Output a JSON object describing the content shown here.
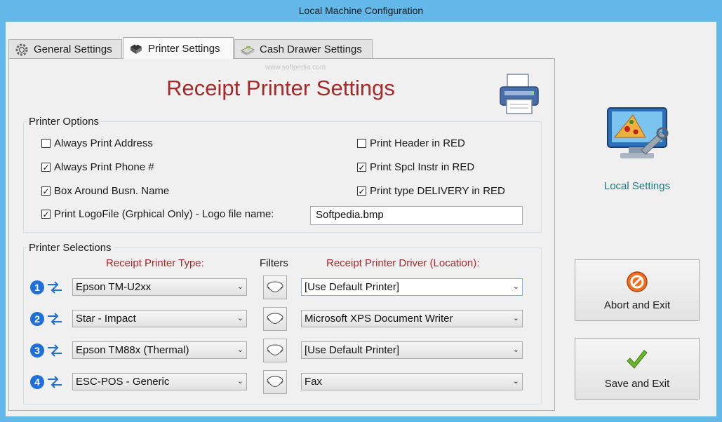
{
  "window": {
    "title": "Local Machine Configuration"
  },
  "tabs": [
    {
      "label": "General Settings",
      "icon": "gear-icon"
    },
    {
      "label": "Printer Settings",
      "icon": "printer-icon",
      "active": true
    },
    {
      "label": "Cash Drawer Settings",
      "icon": "cash-drawer-icon"
    }
  ],
  "watermark": "www.softpedia.com",
  "heading": "Receipt Printer Settings",
  "printer_options": {
    "legend": "Printer Options",
    "left": [
      {
        "label": "Always Print Address",
        "checked": false
      },
      {
        "label": "Always Print Phone #",
        "checked": true
      },
      {
        "label": "Box Around Busn. Name",
        "checked": true
      }
    ],
    "right": [
      {
        "label": "Print Header in RED",
        "checked": false
      },
      {
        "label": "Print Spcl Instr in RED",
        "checked": true
      },
      {
        "label": "Print type DELIVERY in RED",
        "checked": true
      }
    ],
    "logo": {
      "label": "Print LogoFile (Grphical Only) - Logo file name:",
      "checked": true,
      "value": "Softpedia.bmp"
    }
  },
  "printer_selections": {
    "legend": "Printer Selections",
    "col_type": "Receipt Printer Type:",
    "col_filters": "Filters",
    "col_driver": "Receipt Printer Driver (Location):",
    "rows": [
      {
        "num": "1",
        "type": "Epson TM-U2xx",
        "driver": "[Use Default Printer]"
      },
      {
        "num": "2",
        "type": "Star - Impact",
        "driver": "Microsoft XPS Document Writer"
      },
      {
        "num": "3",
        "type": "Epson TM88x (Thermal)",
        "driver": "[Use Default Printer]"
      },
      {
        "num": "4",
        "type": "ESC-POS - Generic",
        "driver": "Fax"
      }
    ]
  },
  "side": {
    "local_label": "Local Settings",
    "abort_label": "Abort and Exit",
    "save_label": "Save and Exit"
  },
  "colors": {
    "accent_red": "#a52a2a",
    "teal": "#1b7a7d",
    "frame": "#63b8ea",
    "number_blue": "#1e6fd9"
  }
}
